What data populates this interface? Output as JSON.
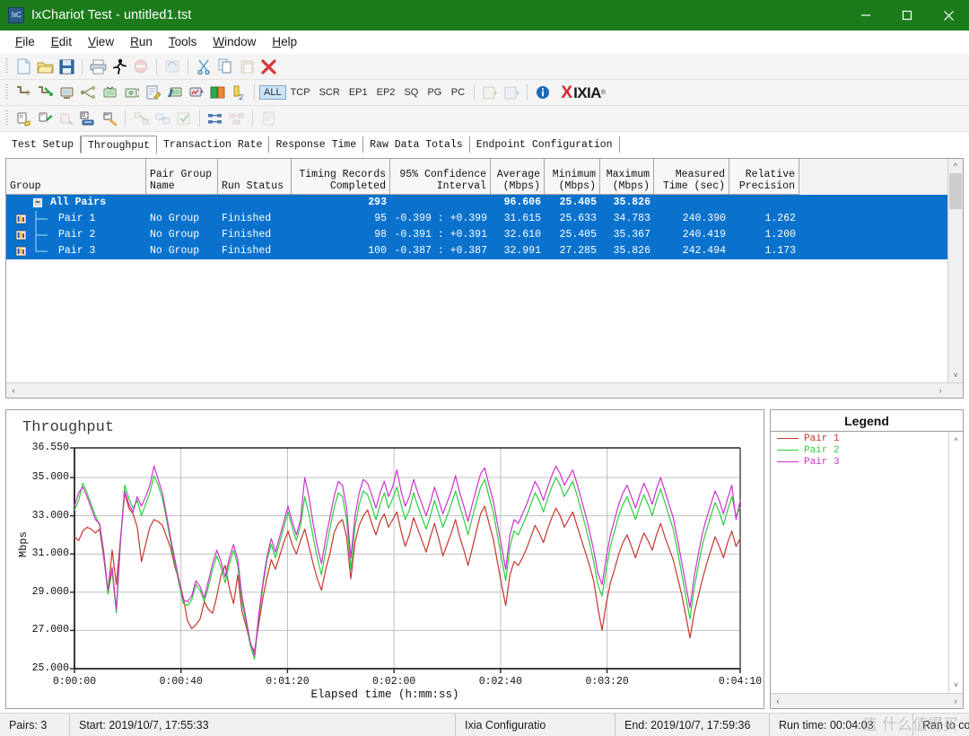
{
  "window": {
    "title": "IxChariot Test - untitled1.tst",
    "app_icon": "ixchariot-icon",
    "titlebar_color": "#1c7c1c",
    "minimize": "minimize-icon",
    "maximize": "maximize-icon",
    "close": "close-icon"
  },
  "menu": [
    {
      "label": "File",
      "accel": "F"
    },
    {
      "label": "Edit",
      "accel": "E"
    },
    {
      "label": "View",
      "accel": "V"
    },
    {
      "label": "Run",
      "accel": "R"
    },
    {
      "label": "Tools",
      "accel": "T"
    },
    {
      "label": "Window",
      "accel": "W"
    },
    {
      "label": "Help",
      "accel": "H"
    }
  ],
  "toolbars": {
    "row1": [
      "new-document-icon",
      "open-folder-icon",
      "save-disk-icon",
      "print-icon",
      "run-test-icon",
      "stop-test-icon",
      "refresh-icon",
      "cut-scissors-icon",
      "copy-pages-icon",
      "paste-icon",
      "delete-x-icon"
    ],
    "row2": [
      "add-pair-icon",
      "add-pair-wizard-icon",
      "add-endpoint-pair-icon",
      "add-multicast-pair-icon",
      "add-vod-pair-icon",
      "add-voip-pair-icon",
      "edit-script-icon",
      "hardware-pair-icon",
      "hardware-performance-icon",
      "pair-compare-icon",
      "duplicate-pair-icon"
    ],
    "row3": [
      "setup-group-icon",
      "run-group-icon",
      "clear-group-icon",
      "group-pairs-icon",
      "ungroup-pairs-icon",
      "validate-icon",
      "swap-endpoints-icon",
      "check-connection-icon",
      "align-icon",
      "distribute-icon",
      "report-icon"
    ],
    "filters": [
      {
        "label": "ALL",
        "active": true
      },
      {
        "label": "TCP",
        "active": false
      },
      {
        "label": "SCR",
        "active": false
      },
      {
        "label": "EP1",
        "active": false
      },
      {
        "label": "EP2",
        "active": false
      },
      {
        "label": "SQ",
        "active": false
      },
      {
        "label": "PG",
        "active": false
      },
      {
        "label": "PC",
        "active": false
      }
    ],
    "extra": [
      "export-icon",
      "import-icon",
      "info-icon"
    ],
    "brand": {
      "x": "X",
      "word": "IXIA",
      "reg": "®"
    }
  },
  "tabs": [
    {
      "label": "Test Setup",
      "active": false
    },
    {
      "label": "Throughput",
      "active": true
    },
    {
      "label": "Transaction Rate",
      "active": false
    },
    {
      "label": "Response Time",
      "active": false
    },
    {
      "label": "Raw Data Totals",
      "active": false
    },
    {
      "label": "Endpoint Configuration",
      "active": false
    }
  ],
  "table": {
    "columns": [
      {
        "label": "Group",
        "align": "left",
        "width": 156
      },
      {
        "label": "Pair Group\nName",
        "line1": "Pair Group",
        "line2": "Name",
        "align": "left",
        "width": 80
      },
      {
        "label": "Run Status",
        "line1": "",
        "line2": "Run Status",
        "align": "left",
        "width": 82
      },
      {
        "label": "Timing Records\nCompleted",
        "line1": "Timing Records",
        "line2": "Completed",
        "align": "right",
        "width": 110
      },
      {
        "label": "95% Confidence\nInterval",
        "line1": "95% Confidence",
        "line2": "Interval",
        "align": "right",
        "width": 112
      },
      {
        "label": "Average\n(Mbps)",
        "line1": "Average",
        "line2": "(Mbps)",
        "align": "right",
        "width": 60
      },
      {
        "label": "Minimum\n(Mbps)",
        "line1": "Minimum",
        "line2": "(Mbps)",
        "align": "right",
        "width": 62
      },
      {
        "label": "Maximum\n(Mbps)",
        "line1": "Maximum",
        "line2": "(Mbps)",
        "align": "right",
        "width": 60
      },
      {
        "label": "Measured\nTime (sec)",
        "line1": "Measured",
        "line2": "Time (sec)",
        "align": "right",
        "width": 84
      },
      {
        "label": "Relative\nPrecision",
        "line1": "Relative",
        "line2": "Precision",
        "align": "right",
        "width": 78
      }
    ],
    "rows": [
      {
        "type": "group",
        "expander": "−",
        "group": "All Pairs",
        "pair_group_name": "",
        "run_status": "",
        "timing_records": "293",
        "confidence": "",
        "average": "96.606",
        "minimum": "25.405",
        "maximum": "35.826",
        "measured_time": "",
        "relative_precision": "",
        "selected": true
      },
      {
        "type": "pair",
        "icon": "pair-chart-icon",
        "group": "Pair 1",
        "pair_group_name": "No Group",
        "run_status": "Finished",
        "timing_records": "95",
        "confidence": "-0.399 : +0.399",
        "average": "31.615",
        "minimum": "25.633",
        "maximum": "34.783",
        "measured_time": "240.390",
        "relative_precision": "1.262",
        "selected": true
      },
      {
        "type": "pair",
        "icon": "pair-chart-icon",
        "group": "Pair 2",
        "pair_group_name": "No Group",
        "run_status": "Finished",
        "timing_records": "98",
        "confidence": "-0.391 : +0.391",
        "average": "32.610",
        "minimum": "25.405",
        "maximum": "35.367",
        "measured_time": "240.419",
        "relative_precision": "1.200",
        "selected": true
      },
      {
        "type": "pair",
        "icon": "pair-chart-icon",
        "group": "Pair 3",
        "pair_group_name": "No Group",
        "run_status": "Finished",
        "timing_records": "100",
        "confidence": "-0.387 : +0.387",
        "average": "32.991",
        "minimum": "27.285",
        "maximum": "35.826",
        "measured_time": "242.494",
        "relative_precision": "1.173",
        "selected": true
      }
    ],
    "selection_color": "#0a72cd"
  },
  "legend": {
    "title": "Legend",
    "items": [
      {
        "label": "Pair 1",
        "color": "#c4362f"
      },
      {
        "label": "Pair 2",
        "color": "#2ecc40"
      },
      {
        "label": "Pair 3",
        "color": "#cc33cc"
      }
    ]
  },
  "statusbar": {
    "pairs": "Pairs: 3",
    "start": "Start: 2019/10/7, 17:55:33",
    "config": "Ixia Configuratio",
    "end": "End: 2019/10/7, 17:59:36",
    "runtime": "Run time: 00:04:03",
    "result": "Ran to completion"
  },
  "watermark": "值 什么值得买",
  "chart_data": {
    "type": "line",
    "title": "Throughput",
    "xlabel": "Elapsed time (h:mm:ss)",
    "ylabel": "Mbps",
    "ylim": [
      25.0,
      36.55
    ],
    "yticks": [
      "25.000",
      "27.000",
      "29.000",
      "31.000",
      "33.000",
      "35.000",
      "36.550"
    ],
    "ytick_values": [
      25.0,
      27.0,
      29.0,
      31.0,
      33.0,
      35.0,
      36.55
    ],
    "xticks": [
      "0:00:00",
      "0:00:40",
      "0:01:20",
      "0:02:00",
      "0:02:40",
      "0:03:20",
      "0:04:10"
    ],
    "xtick_values": [
      0,
      40,
      80,
      120,
      160,
      200,
      250
    ],
    "xlim": [
      0,
      250
    ],
    "grid": true,
    "legend_position": "right-panel",
    "series": [
      {
        "name": "Pair 1",
        "color": "#c4362f",
        "values": [
          31.9,
          31.7,
          32.2,
          32.4,
          32.3,
          32.1,
          32.3,
          30.8,
          29.0,
          31.2,
          29.4,
          31.8,
          34.2,
          33.4,
          33.1,
          32.4,
          30.6,
          31.5,
          32.4,
          32.8,
          32.7,
          32.5,
          31.9,
          31.3,
          30.3,
          29.6,
          28.7,
          27.5,
          27.1,
          27.3,
          27.6,
          28.5,
          28.1,
          27.9,
          28.8,
          29.9,
          30.4,
          29.2,
          28.4,
          29.9,
          28.0,
          27.2,
          26.3,
          25.9,
          27.3,
          28.7,
          29.8,
          30.7,
          30.2,
          30.9,
          31.6,
          32.2,
          31.5,
          31.0,
          31.7,
          32.3,
          31.4,
          30.5,
          29.7,
          29.1,
          30.2,
          31.0,
          32.1,
          32.6,
          32.8,
          31.9,
          29.7,
          31.6,
          32.5,
          33.0,
          33.3,
          32.6,
          32.0,
          32.7,
          33.1,
          32.4,
          32.8,
          33.2,
          32.2,
          31.4,
          32.0,
          32.9,
          32.3,
          31.7,
          31.1,
          31.9,
          32.6,
          31.8,
          30.9,
          31.5,
          32.1,
          32.8,
          31.9,
          31.2,
          30.4,
          31.3,
          32.2,
          33.1,
          33.5,
          32.6,
          31.8,
          30.6,
          29.4,
          28.3,
          29.9,
          30.6,
          30.4,
          30.8,
          31.3,
          31.9,
          32.5,
          32.1,
          31.6,
          32.3,
          32.9,
          33.4,
          33.0,
          32.4,
          32.8,
          33.2,
          32.5,
          31.8,
          31.1,
          30.4,
          29.6,
          28.2,
          27.0,
          28.4,
          29.5,
          30.2,
          31.0,
          31.6,
          32.0,
          31.4,
          30.8,
          31.5,
          32.1,
          31.7,
          31.2,
          32.0,
          32.6,
          31.9,
          31.3,
          30.7,
          29.8,
          28.9,
          27.8,
          26.6,
          27.9,
          28.8,
          29.7,
          30.5,
          31.2,
          31.9,
          31.4,
          30.8,
          31.6,
          32.2,
          31.4,
          31.8
        ]
      },
      {
        "name": "Pair 2",
        "color": "#2ecc40",
        "values": [
          33.3,
          33.8,
          34.7,
          34.2,
          33.6,
          33.0,
          32.5,
          31.0,
          28.9,
          30.1,
          27.9,
          31.6,
          34.6,
          33.9,
          33.4,
          33.8,
          33.0,
          33.6,
          34.2,
          35.1,
          34.6,
          33.9,
          32.8,
          31.6,
          30.5,
          29.4,
          28.4,
          28.3,
          28.6,
          29.4,
          29.1,
          28.5,
          29.3,
          30.2,
          30.9,
          30.3,
          29.5,
          30.5,
          31.2,
          30.4,
          28.5,
          27.4,
          26.2,
          25.5,
          27.6,
          29.3,
          30.7,
          31.5,
          30.8,
          31.6,
          32.4,
          33.2,
          32.4,
          31.7,
          32.5,
          34.0,
          33.1,
          31.9,
          30.8,
          29.9,
          31.2,
          32.3,
          33.4,
          34.2,
          34.0,
          32.8,
          30.2,
          32.4,
          33.6,
          34.3,
          34.1,
          33.5,
          32.8,
          33.6,
          34.2,
          33.4,
          33.9,
          34.5,
          33.6,
          32.8,
          33.3,
          34.2,
          33.5,
          32.9,
          32.3,
          33.0,
          33.8,
          33.1,
          32.4,
          33.0,
          33.6,
          34.3,
          33.5,
          32.8,
          32.0,
          32.9,
          33.7,
          34.5,
          34.9,
          34.0,
          33.2,
          32.0,
          30.8,
          29.6,
          31.4,
          32.2,
          32.0,
          32.5,
          33.0,
          33.6,
          34.2,
          33.8,
          33.2,
          33.9,
          34.5,
          35.0,
          34.6,
          34.0,
          34.4,
          34.8,
          34.1,
          33.3,
          32.5,
          31.6,
          30.6,
          29.4,
          28.8,
          30.2,
          31.4,
          32.2,
          33.0,
          33.6,
          34.0,
          33.4,
          32.8,
          33.5,
          34.1,
          33.6,
          33.0,
          33.8,
          34.4,
          33.7,
          33.0,
          32.3,
          31.2,
          30.0,
          28.8,
          27.6,
          29.2,
          30.4,
          31.5,
          32.3,
          33.0,
          33.7,
          33.2,
          32.5,
          33.3,
          34.0,
          33.0,
          33.4
        ]
      },
      {
        "name": "Pair 3",
        "color": "#cc33cc",
        "values": [
          33.5,
          34.2,
          34.5,
          34.0,
          33.4,
          32.8,
          32.6,
          31.1,
          29.1,
          30.3,
          28.1,
          31.8,
          34.3,
          33.6,
          33.2,
          34.0,
          33.5,
          34.0,
          34.6,
          35.6,
          34.9,
          34.2,
          33.0,
          31.8,
          30.7,
          29.6,
          28.6,
          28.5,
          28.8,
          29.6,
          29.3,
          28.7,
          29.6,
          30.5,
          31.2,
          30.6,
          29.8,
          30.8,
          31.5,
          30.7,
          28.8,
          27.6,
          26.4,
          25.7,
          27.8,
          29.5,
          30.9,
          31.8,
          31.1,
          31.9,
          32.7,
          33.5,
          32.7,
          32.0,
          32.8,
          35.0,
          34.0,
          32.6,
          31.4,
          30.5,
          31.8,
          32.9,
          34.0,
          34.8,
          34.6,
          33.4,
          30.8,
          33.0,
          34.2,
          34.9,
          34.7,
          34.1,
          33.4,
          34.2,
          34.8,
          34.0,
          34.5,
          35.4,
          34.3,
          33.5,
          34.0,
          34.9,
          34.2,
          33.6,
          33.0,
          33.7,
          34.5,
          33.8,
          33.1,
          33.7,
          34.3,
          35.1,
          34.2,
          33.5,
          32.7,
          33.6,
          34.4,
          35.2,
          35.5,
          34.6,
          33.8,
          32.6,
          31.4,
          30.2,
          32.0,
          32.8,
          32.6,
          33.1,
          33.6,
          34.2,
          34.8,
          34.4,
          33.8,
          34.5,
          35.1,
          35.6,
          35.2,
          34.6,
          35.0,
          35.4,
          34.7,
          33.9,
          33.1,
          32.2,
          31.2,
          30.0,
          29.4,
          30.8,
          32.0,
          32.8,
          33.6,
          34.2,
          34.6,
          34.0,
          33.4,
          34.1,
          34.7,
          34.2,
          33.6,
          34.4,
          35.0,
          34.3,
          33.6,
          32.9,
          31.8,
          30.6,
          29.4,
          28.2,
          29.8,
          31.0,
          32.1,
          32.9,
          33.6,
          34.3,
          33.8,
          33.1,
          33.9,
          34.6,
          32.8,
          33.8
        ]
      }
    ]
  }
}
